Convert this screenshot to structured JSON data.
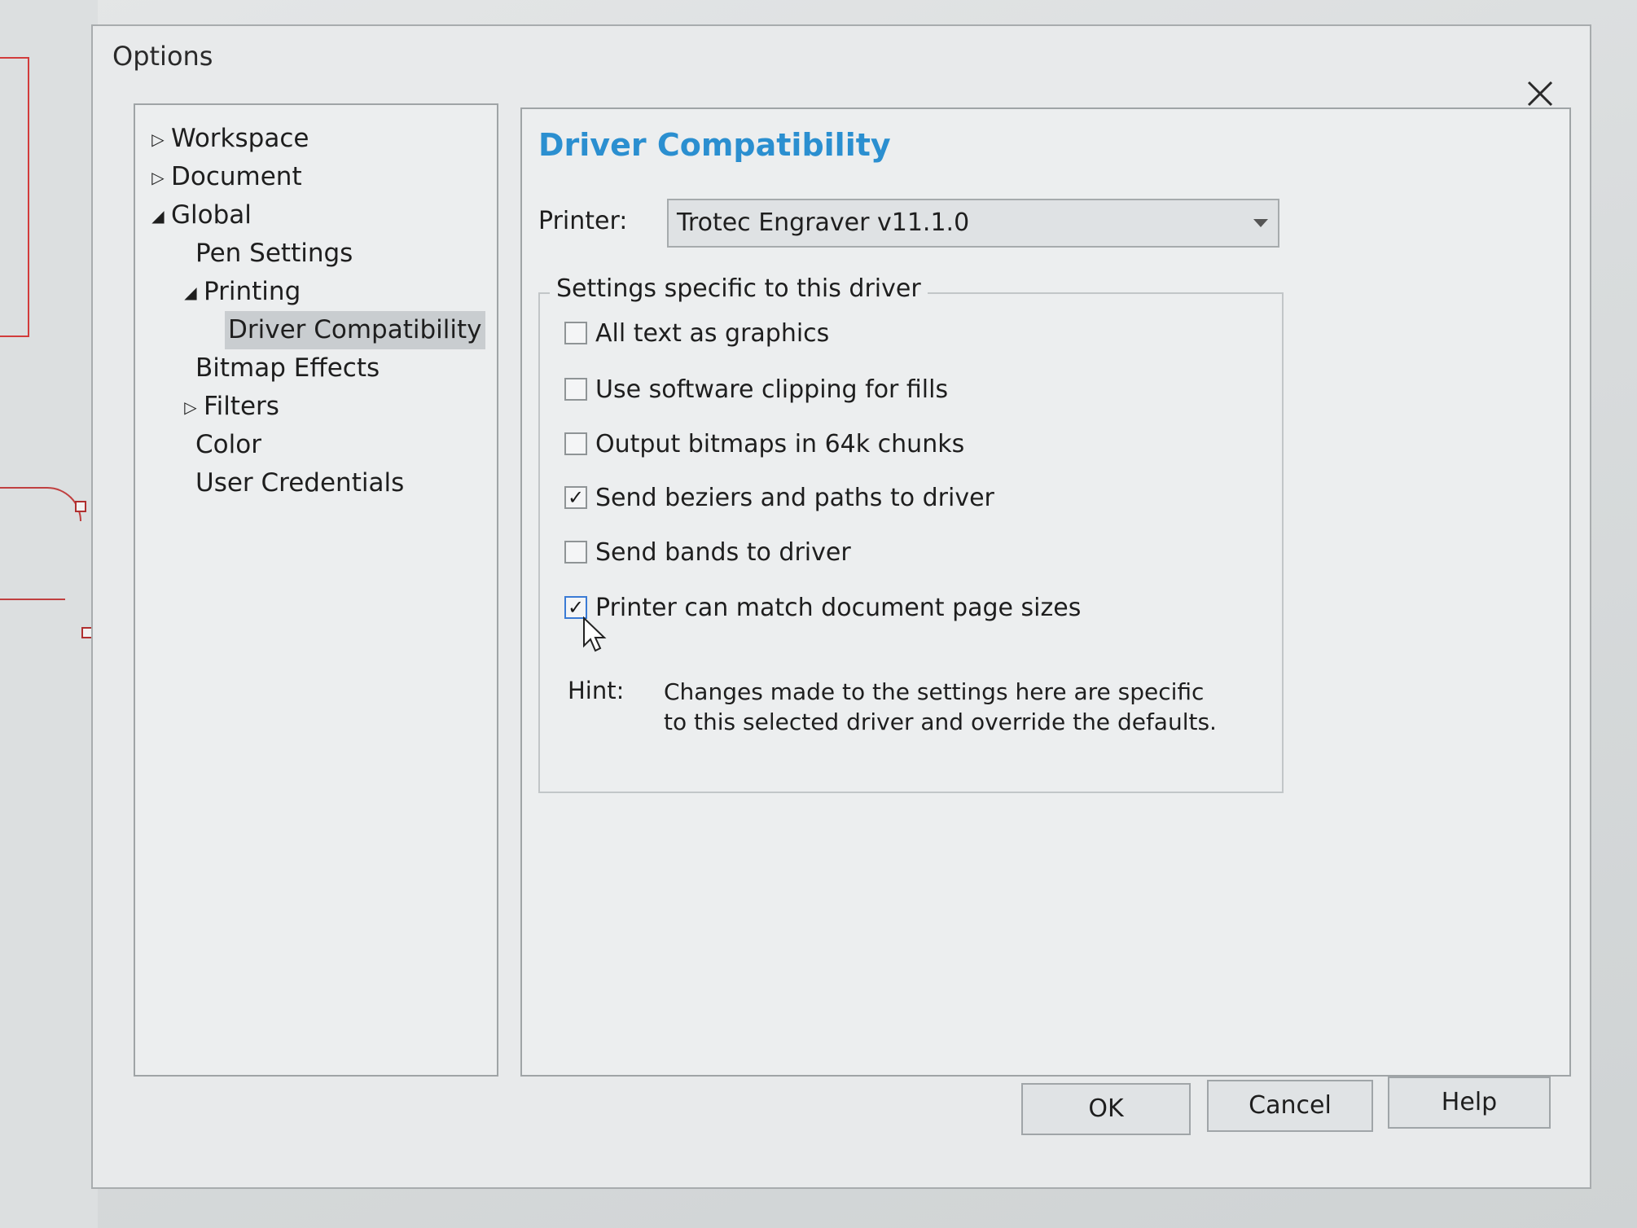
{
  "dialog": {
    "title": "Options",
    "close_icon": "close-icon"
  },
  "tree": {
    "items": [
      {
        "label": "Workspace",
        "arrow": "▷",
        "level": 0,
        "state": "collapsed"
      },
      {
        "label": "Document",
        "arrow": "▷",
        "level": 0,
        "state": "collapsed"
      },
      {
        "label": "Global",
        "arrow": "◢",
        "level": 0,
        "state": "expanded"
      },
      {
        "label": "Pen Settings",
        "arrow": "",
        "level": 1
      },
      {
        "label": "Printing",
        "arrow": "◢",
        "level": 1,
        "state": "expanded"
      },
      {
        "label": "Driver Compatibility",
        "arrow": "",
        "level": 2,
        "selected": true
      },
      {
        "label": "Bitmap Effects",
        "arrow": "",
        "level": 1
      },
      {
        "label": "Filters",
        "arrow": "▷",
        "level": 1,
        "state": "collapsed"
      },
      {
        "label": "Color",
        "arrow": "",
        "level": 1
      },
      {
        "label": "User Credentials",
        "arrow": "",
        "level": 1
      }
    ]
  },
  "content": {
    "title": "Driver Compatibility",
    "title_color": "#2b8fd0",
    "printer_label": "Printer:",
    "printer_value": "Trotec Engraver v11.1.0",
    "group_legend": "Settings specific to this driver",
    "options": [
      {
        "label": "All text as graphics",
        "checked": false
      },
      {
        "label": "Use software clipping for fills",
        "checked": false
      },
      {
        "label": "Output bitmaps in 64k chunks",
        "checked": false
      },
      {
        "label": "Send beziers and paths to driver",
        "checked": true
      },
      {
        "label": "Send bands to driver",
        "checked": false
      },
      {
        "label": "Printer can match document page sizes",
        "checked": true
      }
    ],
    "hint_label": "Hint:",
    "hint_text": "Changes made to the settings here are specific to this selected driver and override the defaults."
  },
  "buttons": {
    "ok": "OK",
    "cancel": "Cancel",
    "help": "Help"
  }
}
